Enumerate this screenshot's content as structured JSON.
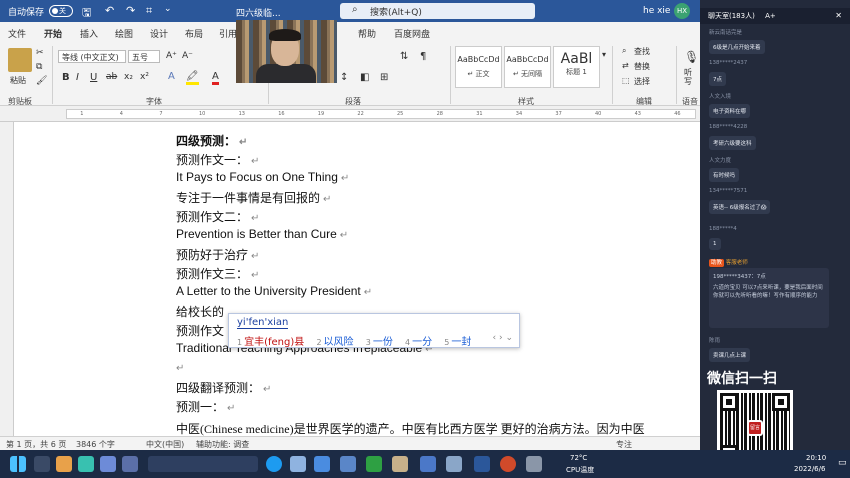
{
  "titlebar": {
    "autosave_label": "自动保存",
    "autosave_state": "关",
    "doc_title": "四六级临...",
    "search_placeholder": "搜索(Alt+Q)",
    "user_name": "he xie",
    "user_initials": "HX"
  },
  "menu": {
    "items": [
      "文件",
      "开始",
      "插入",
      "绘图",
      "设计",
      "布局",
      "引用",
      "帮助",
      "百度网盘"
    ],
    "active": "开始"
  },
  "ribbon": {
    "paste_label": "粘贴",
    "clipboard_group": "剪贴板",
    "font_name": "等线 (中文正文)",
    "font_size": "五号",
    "font_group": "字体",
    "paragraph_group": "段落",
    "styles": [
      {
        "preview": "AaBbCcDd",
        "name": "↵ 正文"
      },
      {
        "preview": "AaBbCcDd",
        "name": "↵ 无间隔"
      },
      {
        "preview": "AaBl",
        "name": "标题 1"
      }
    ],
    "styles_group": "样式",
    "find_label": "查找",
    "replace_label": "替换",
    "select_label": "选择",
    "edit_group": "编辑",
    "dictate_label": "听写",
    "voice_group": "语音"
  },
  "document": {
    "lines": [
      {
        "text": "四级预测：",
        "bold": true
      },
      {
        "text": "预测作文一："
      },
      {
        "text": "It Pays to Focus on One Thing"
      },
      {
        "text": "专注于一件事情是有回报的"
      },
      {
        "text": "预测作文二："
      },
      {
        "text": "Prevention is Better than Cure"
      },
      {
        "text": "预防好于治疗"
      },
      {
        "text": "预测作文三："
      },
      {
        "text": "A Letter to the University President"
      },
      {
        "text": "给校长的"
      },
      {
        "text": "预测作文"
      },
      {
        "text": "Traditional Teaching Approaches Irreplaceable"
      },
      {
        "text": ""
      },
      {
        "text": "四级翻译预测："
      },
      {
        "text": "预测一："
      },
      {
        "text": "中医(Chinese medicine)是世界医学的遗产。中医有比西方医学 更好的治病方法。因为中医"
      }
    ]
  },
  "ime": {
    "composition": "yi'fen'xian",
    "candidates": [
      {
        "num": "1",
        "text": "宜丰(feng)县"
      },
      {
        "num": "2",
        "text": "以风险"
      },
      {
        "num": "3",
        "text": "一份"
      },
      {
        "num": "4",
        "text": "一分"
      },
      {
        "num": "5",
        "text": "一封"
      }
    ]
  },
  "statusbar": {
    "page": "第 1 页，共 6 页",
    "words": "3846 个字",
    "lang": "中文(中国)",
    "a11y": "辅助功能: 调查",
    "focus": "专注"
  },
  "chat": {
    "header": "聊天室(183人)",
    "font_btn": "A+",
    "messages": [
      {
        "user": "新云南话完是",
        "text": "6级是几点开始来着"
      },
      {
        "user": "138*****2437",
        "text": "7点"
      },
      {
        "user": "人文入境",
        "text": "电子资料在哪"
      },
      {
        "user": "188*****4228",
        "text": "考研六级要这科"
      },
      {
        "user": "人文力度",
        "text": "有时候吗"
      },
      {
        "user": "134*****7571",
        "text": "英语-- 6级报名过了😱"
      },
      {
        "user": "188*****4",
        "text": "1"
      }
    ],
    "teacher_tag": "助教",
    "teacher_name": "客服老师",
    "teacher_quote": "198*****3437：7点",
    "teacher_reply": "六道的宝贝 可以7点来听课，要是我后面时间你就可以先听听看的嘛！写作有顺序的能力",
    "last_user": "陈雨",
    "last_text": "卖课几点上课"
  },
  "promo": {
    "wechat_scan": "微信扫一扫",
    "qr_badge": "留言"
  },
  "tray": {
    "temp": "72°C",
    "cpu": "CPU温度",
    "time": "20:10",
    "date": "2022/6/6"
  }
}
